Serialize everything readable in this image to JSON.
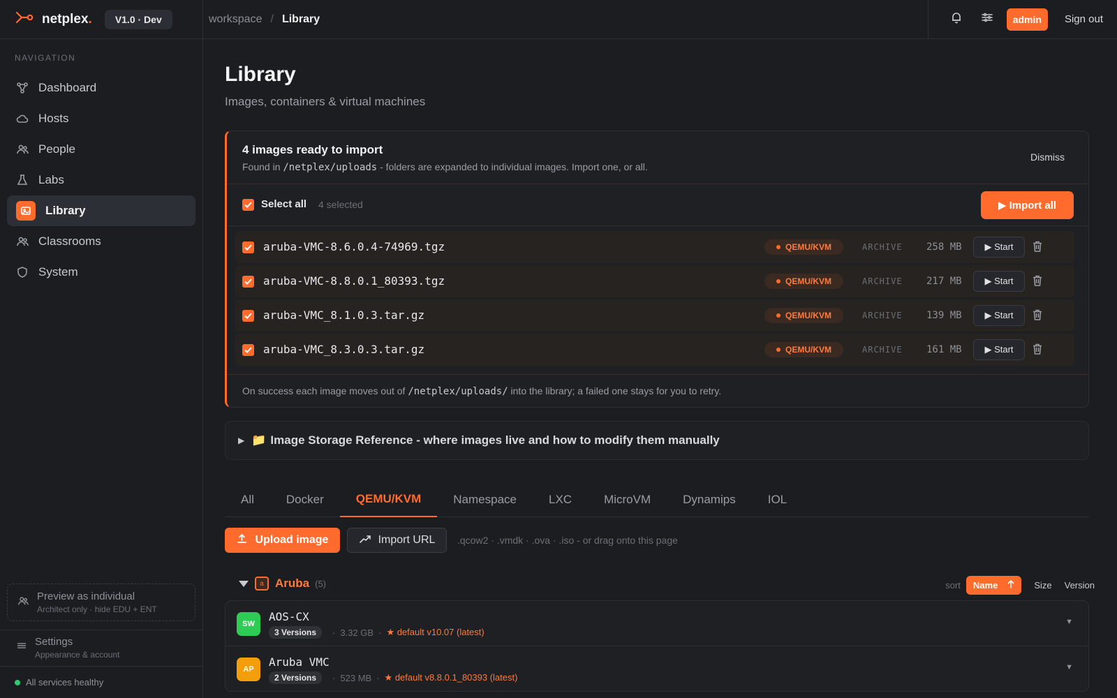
{
  "brand": {
    "name": "netplex",
    "dot": ".",
    "version": "V1.0 · Dev"
  },
  "breadcrumb": {
    "root": "workspace",
    "sep": "/",
    "current": "Library"
  },
  "header": {
    "admin_label": "admin",
    "signout_label": "Sign out"
  },
  "sidebar": {
    "heading": "NAVIGATION",
    "items": [
      {
        "label": "Dashboard",
        "icon": "graph-icon"
      },
      {
        "label": "Hosts",
        "icon": "cloud-icon"
      },
      {
        "label": "People",
        "icon": "people-icon"
      },
      {
        "label": "Labs",
        "icon": "flask-icon"
      },
      {
        "label": "Library",
        "icon": "image-icon",
        "active": true
      },
      {
        "label": "Classrooms",
        "icon": "classroom-icon"
      },
      {
        "label": "System",
        "icon": "shield-icon"
      }
    ],
    "preview": {
      "title": "Preview as individual",
      "subtitle": "Architect only · hide EDU + ENT"
    },
    "settings": {
      "title": "Settings",
      "subtitle": "Appearance & account"
    },
    "health": "All services healthy"
  },
  "page": {
    "title": "Library",
    "subtitle": "Images, containers & virtual machines"
  },
  "import_panel": {
    "title": "4 images ready to import",
    "desc_prefix": "Found in ",
    "desc_path": "/netplex/uploads",
    "desc_suffix": " - folders are expanded to individual images. Import one, or all.",
    "dismiss_label": "Dismiss",
    "select_all_label": "Select all",
    "selected_count": "4 selected",
    "import_all_label": "▶ Import all",
    "files": [
      {
        "name": "aruba-VMC-8.6.0.4-74969.tgz",
        "type": "QEMU/KVM",
        "kind": "ARCHIVE",
        "size": "258 MB",
        "action": "▶ Start"
      },
      {
        "name": "aruba-VMC-8.8.0.1_80393.tgz",
        "type": "QEMU/KVM",
        "kind": "ARCHIVE",
        "size": "217 MB",
        "action": "▶ Start"
      },
      {
        "name": "aruba-VMC_8.1.0.3.tar.gz",
        "type": "QEMU/KVM",
        "kind": "ARCHIVE",
        "size": "139 MB",
        "action": "▶ Start"
      },
      {
        "name": "aruba-VMC_8.3.0.3.tar.gz",
        "type": "QEMU/KVM",
        "kind": "ARCHIVE",
        "size": "161 MB",
        "action": "▶ Start"
      }
    ],
    "footer_prefix": "On success each image moves out of ",
    "footer_path": "/netplex/uploads/",
    "footer_suffix": " into the library; a failed one stays for you to retry."
  },
  "storage_ref": {
    "arrow": "▶",
    "icon": "📁",
    "label": "Image Storage Reference - where images live and how to modify them manually"
  },
  "tabs": [
    {
      "label": "All"
    },
    {
      "label": "Docker"
    },
    {
      "label": "QEMU/KVM",
      "active": true
    },
    {
      "label": "Namespace"
    },
    {
      "label": "LXC"
    },
    {
      "label": "MicroVM"
    },
    {
      "label": "Dynamips"
    },
    {
      "label": "IOL"
    }
  ],
  "actions": {
    "upload_label": "Upload image",
    "import_url_label": "Import URL",
    "format_hint": ".qcow2 · .vmdk · .ova · .iso - or drag onto this page"
  },
  "group": {
    "name": "Aruba",
    "count": "(5)",
    "sort_label": "sort",
    "sort_active": "Name",
    "sort_options": [
      "Size",
      "Version"
    ]
  },
  "images": [
    {
      "avatar": "SW",
      "avatar_color": "#2ecc55",
      "name": "AOS-CX",
      "versions": "3 Versions",
      "size": "3.32 GB",
      "default": "★ default v10.07 (latest)"
    },
    {
      "avatar": "AP",
      "avatar_color": "#f59e0b",
      "name": "Aruba VMC",
      "versions": "2 Versions",
      "size": "523 MB",
      "default": "★ default v8.8.0.1_80393 (latest)"
    }
  ],
  "colors": {
    "accent": "#ff6b2c",
    "bg": "#1b1d21",
    "healthy": "#2ecc71"
  }
}
